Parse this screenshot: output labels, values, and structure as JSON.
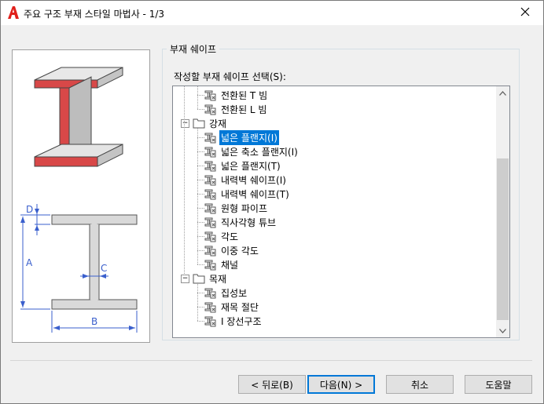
{
  "window": {
    "title": "주요 구조 부재 스타일 마법사 - 1/3"
  },
  "icons": {
    "app": "autocad-a-icon",
    "close": "close-icon"
  },
  "illustration": {
    "dims": {
      "d": "D",
      "a": "A",
      "c": "C",
      "b": "B"
    }
  },
  "group": {
    "title": "부재 쉐이프",
    "prompt": "작성할 부재 쉐이프 선택(S):"
  },
  "tree": {
    "items": [
      {
        "label": "전환된 T 빔",
        "level": 2,
        "type": "shape"
      },
      {
        "label": "전환된 L 빔",
        "level": 2,
        "type": "shape"
      },
      {
        "label": "강재",
        "level": 1,
        "type": "folder",
        "expanded": true
      },
      {
        "label": "넓은 플랜지(I)",
        "level": 2,
        "type": "shape",
        "selected": true
      },
      {
        "label": "넓은 축소 플랜지(I)",
        "level": 2,
        "type": "shape"
      },
      {
        "label": "넓은 플랜지(T)",
        "level": 2,
        "type": "shape"
      },
      {
        "label": "내력벽 쉐이프(I)",
        "level": 2,
        "type": "shape"
      },
      {
        "label": "내력벽 쉐이프(T)",
        "level": 2,
        "type": "shape"
      },
      {
        "label": "원형 파이프",
        "level": 2,
        "type": "shape"
      },
      {
        "label": "직사각형 튜브",
        "level": 2,
        "type": "shape"
      },
      {
        "label": "각도",
        "level": 2,
        "type": "shape"
      },
      {
        "label": "이중 각도",
        "level": 2,
        "type": "shape"
      },
      {
        "label": "채널",
        "level": 2,
        "type": "shape"
      },
      {
        "label": "목재",
        "level": 1,
        "type": "folder",
        "expanded": true
      },
      {
        "label": "집성보",
        "level": 2,
        "type": "shape"
      },
      {
        "label": "재목 절단",
        "level": 2,
        "type": "shape"
      },
      {
        "label": "I 장선구조",
        "level": 2,
        "type": "shape"
      }
    ]
  },
  "buttons": {
    "back": "< 뒤로(B)",
    "next": "다음(N) >",
    "cancel": "취소",
    "help": "도움말"
  },
  "colors": {
    "accent": "#0078d7",
    "flange_red": "#e05050"
  }
}
